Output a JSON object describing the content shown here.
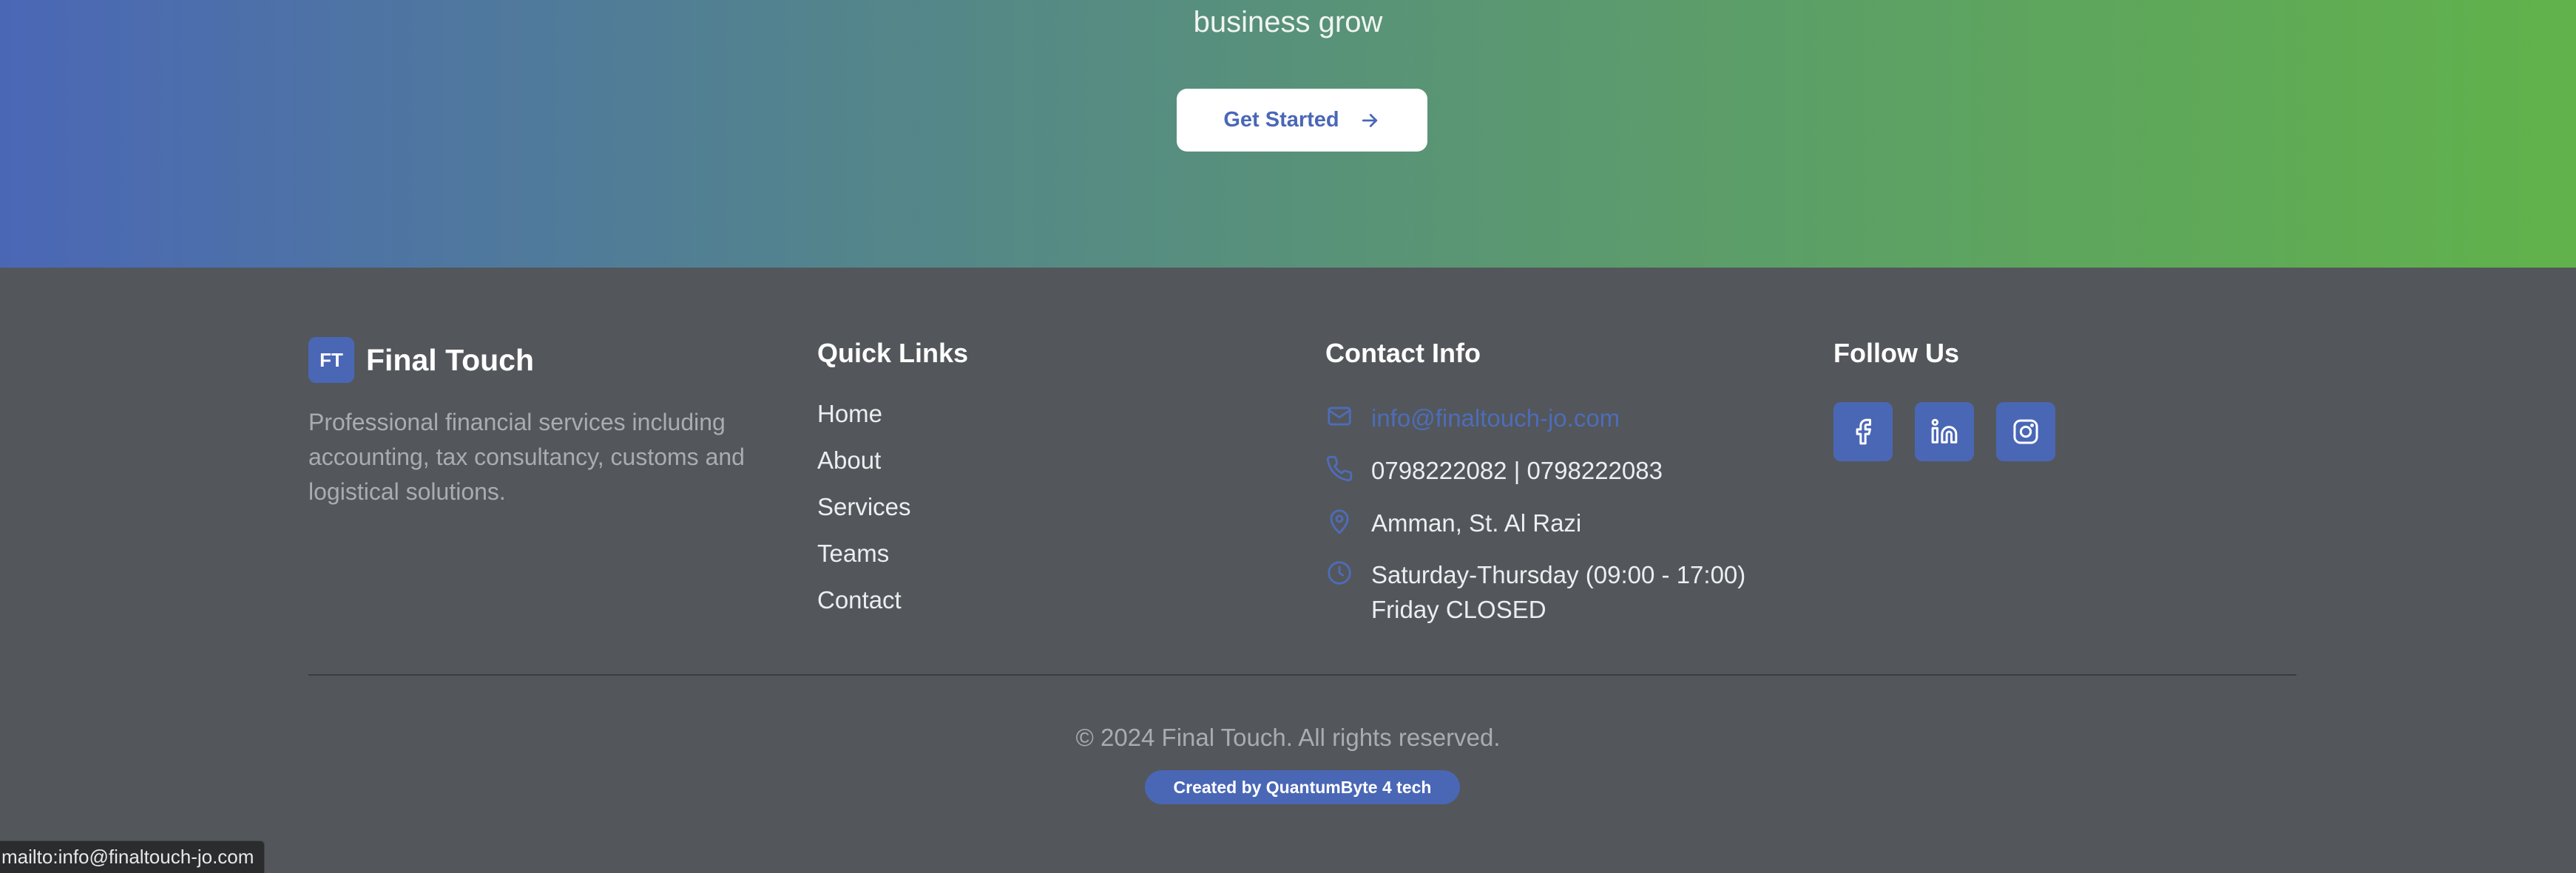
{
  "hero": {
    "subtitle": "business grow",
    "cta_label": "Get Started",
    "cta_icon": "arrow-right-icon",
    "gradient_colors": [
      "#4a67b6",
      "#53848d",
      "#5b9a6e",
      "#61b24b"
    ]
  },
  "brand": {
    "logo_text": "FT",
    "name": "Final Touch",
    "description": "Professional financial services including accounting, tax consultancy, customs and logistical solutions."
  },
  "quick_links": {
    "heading": "Quick Links",
    "items": [
      {
        "label": "Home"
      },
      {
        "label": "About"
      },
      {
        "label": "Services"
      },
      {
        "label": "Teams"
      },
      {
        "label": "Contact"
      }
    ]
  },
  "contact": {
    "heading": "Contact Info",
    "email": "info@finaltouch-jo.com",
    "phone": "0798222082 | 0798222083",
    "address": "Amman, St. Al Razi",
    "hours_line1": "Saturday-Thursday (09:00 - 17:00)",
    "hours_line2": "Friday CLOSED",
    "icons": [
      "mail-icon",
      "phone-icon",
      "map-pin-icon",
      "clock-icon"
    ]
  },
  "social": {
    "heading": "Follow Us",
    "items": [
      {
        "icon": "facebook-icon"
      },
      {
        "icon": "linkedin-icon"
      },
      {
        "icon": "instagram-icon"
      }
    ]
  },
  "bottom": {
    "copyright": "© 2024 Final Touch. All rights reserved.",
    "credit": "Created by QuantumByte 4 tech"
  },
  "status_bar": {
    "url": "mailto:info@finaltouch-jo.com"
  },
  "colors": {
    "accent": "#4a67b6",
    "footer_bg": "#53575b",
    "muted_text": "#a8adb2"
  }
}
